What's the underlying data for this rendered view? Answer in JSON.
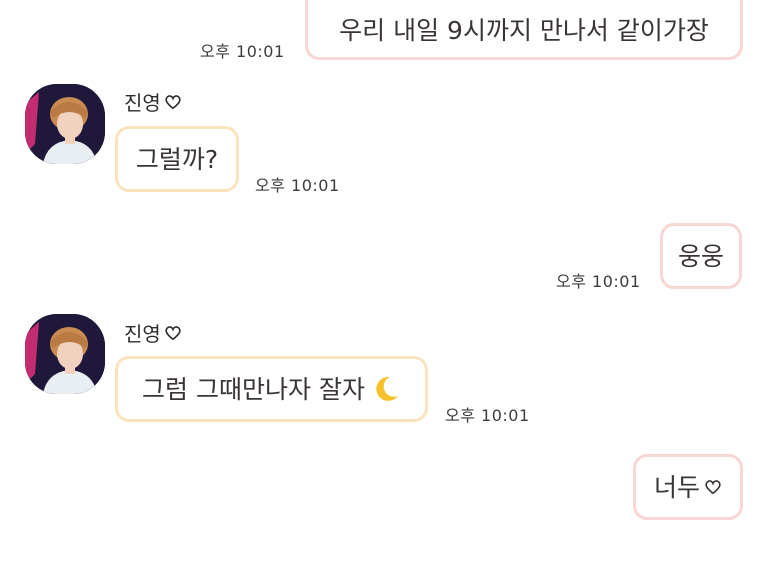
{
  "messages": [
    {
      "sender": "me",
      "text": "우리 내일 9시까지 만나서 같이가장",
      "time": "오후 10:01"
    },
    {
      "sender": "진영",
      "text": "그럴까?",
      "time": "오후 10:01"
    },
    {
      "sender": "me",
      "text": "웅웅",
      "time": "오후 10:01"
    },
    {
      "sender": "진영",
      "text": "그럼 그때만나자 잘자",
      "time": "오후 10:01",
      "emoji": "crescent-moon-icon"
    },
    {
      "sender": "me",
      "text": "너두",
      "time": "오후 10:01",
      "emoji": "heart-icon"
    }
  ],
  "contact": {
    "name": "진영",
    "name_suffix_icon": "heart-icon"
  },
  "colors": {
    "sent_border": "#f8d6d4",
    "received_border": "#fbe3bd",
    "background": "#ffffff",
    "moon": "#f6c12b"
  }
}
